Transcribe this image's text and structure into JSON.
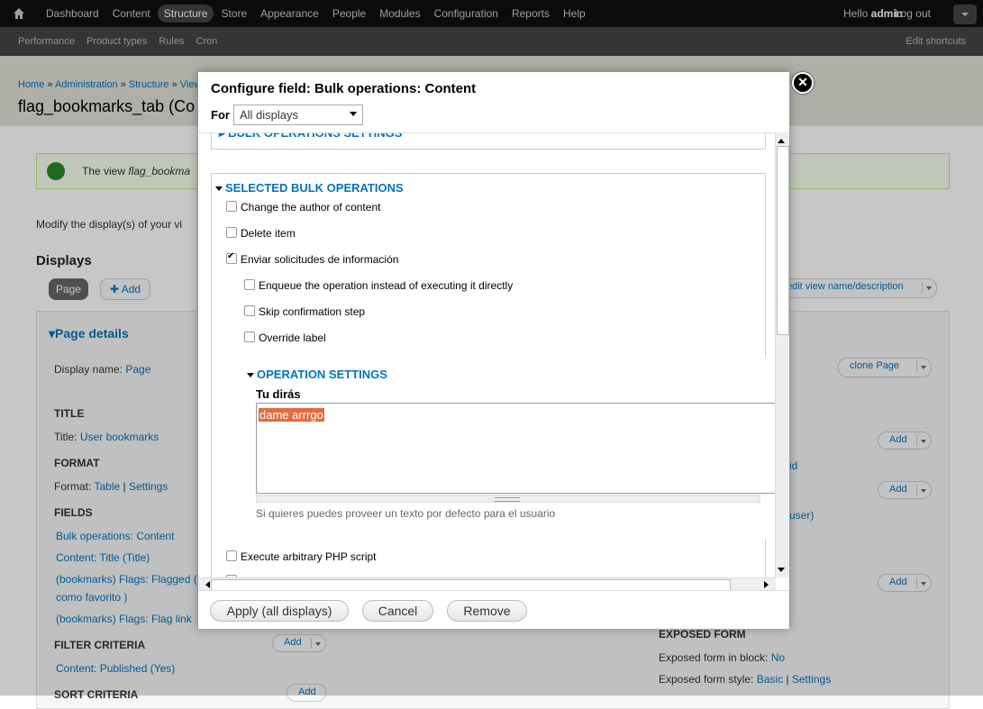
{
  "toolbar": {
    "menu": [
      "Dashboard",
      "Content",
      "Structure",
      "Store",
      "Appearance",
      "People",
      "Modules",
      "Configuration",
      "Reports",
      "Help"
    ],
    "active": "Structure",
    "hello": "Hello",
    "user": "admin",
    "logout": "Log out"
  },
  "shortcuts": {
    "items": [
      "Performance",
      "Product types",
      "Rules",
      "Cron"
    ],
    "edit": "Edit shortcuts"
  },
  "page": {
    "breadcrumb": [
      "Home",
      "Administration",
      "Structure",
      "View"
    ],
    "title": "flag_bookmarks_tab (Co",
    "message_prefix": "The view ",
    "message_em": "flag_bookma",
    "intro": "Modify the display(s) of your vi",
    "displays_heading": "Displays",
    "tab_page": "Page",
    "tab_add": "Add",
    "edit_view": "edit view name/description",
    "page_details": "Page details",
    "display_name_label": "Display name:",
    "display_name_value": "Page",
    "clone_page": "clone Page",
    "title_heading": "TITLE",
    "title_label": "Title:",
    "title_value": "User bookmarks",
    "format_heading": "FORMAT",
    "format_label": "Format:",
    "format_table": "Table",
    "format_settings": "Settings",
    "fields_heading": "FIELDS",
    "fields": [
      "Bulk operations: Content",
      "Content: Title (Title)",
      "(bookmarks) Flags: Flagged (",
      "como favorito )",
      "(bookmarks) Flags: Flag link"
    ],
    "filter_heading": "FILTER CRITERIA",
    "filter_item": "Content: Published (Yes)",
    "sort_heading": "SORT CRITERIA",
    "add_label": "Add",
    "right_id": "id",
    "right_user": "user)",
    "exposed_heading": "EXPOSED FORM",
    "exposed_block_label": "Exposed form in block:",
    "exposed_block_value": "No",
    "exposed_style_label": "Exposed form style:",
    "exposed_style_basic": "Basic",
    "exposed_style_settings": "Settings"
  },
  "dialog": {
    "title": "Configure field: Bulk operations: Content",
    "for_label": "For",
    "for_value": "All displays",
    "bulk_settings_legend": "BULK OPERATIONS SETTINGS",
    "selected_legend": "SELECTED BULK OPERATIONS",
    "operations": [
      {
        "label": "Change the author of content",
        "checked": false
      },
      {
        "label": "Delete item",
        "checked": false
      },
      {
        "label": "Enviar solicitudes de información",
        "checked": true
      }
    ],
    "sub_options": [
      {
        "label": "Enqueue the operation instead of executing it directly",
        "checked": false
      },
      {
        "label": "Skip confirmation step",
        "checked": false
      },
      {
        "label": "Override label",
        "checked": false
      }
    ],
    "op_settings_legend": "OPERATION SETTINGS",
    "textarea_label": "Tu dirás",
    "textarea_value": "dame arrrgo",
    "textarea_help": "Si quieres puedes proveer un texto por defecto para el usuario",
    "php_label": "Execute arbitrary PHP script",
    "apply": "Apply (all displays)",
    "cancel": "Cancel",
    "remove": "Remove"
  }
}
